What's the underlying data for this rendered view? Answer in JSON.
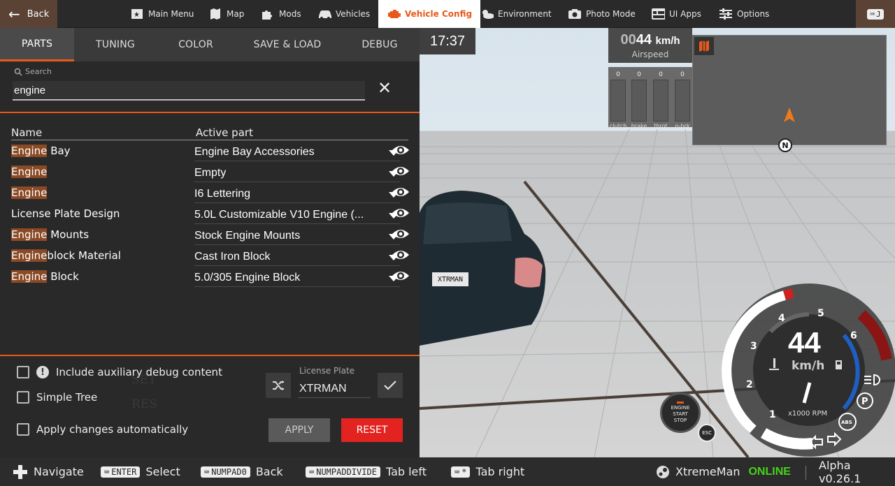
{
  "topbar": {
    "back_label": "Back",
    "nav": [
      {
        "label": "Main Menu",
        "icon": "main-menu-icon"
      },
      {
        "label": "Map",
        "icon": "map-icon"
      },
      {
        "label": "Mods",
        "icon": "puzzle-icon"
      },
      {
        "label": "Vehicles",
        "icon": "car-icon"
      },
      {
        "label": "Vehicle Config",
        "icon": "engine-icon",
        "active": true
      },
      {
        "label": "Environment",
        "icon": "weather-icon"
      },
      {
        "label": "Photo Mode",
        "icon": "camera-icon"
      },
      {
        "label": "UI Apps",
        "icon": "ui-apps-icon"
      },
      {
        "label": "Options",
        "icon": "sliders-icon"
      }
    ],
    "corner_key": "J"
  },
  "panel": {
    "tabs": [
      "PARTS",
      "TUNING",
      "COLOR",
      "SAVE & LOAD",
      "DEBUG"
    ],
    "active_tab": "PARTS",
    "search_label": "Search",
    "search_value": "engine",
    "col_name": "Name",
    "col_active": "Active part",
    "rows": [
      {
        "hl": "Engine",
        "rest": " Bay",
        "part": "Engine Bay Accessories"
      },
      {
        "hl": "Engine",
        "rest": "",
        "part": "Empty"
      },
      {
        "hl": "Engine",
        "rest": "",
        "part": "I6 Lettering"
      },
      {
        "hl": "",
        "rest": "License Plate Design",
        "part": "5.0L Customizable V10 Engine (..."
      },
      {
        "hl": "Engine",
        "rest": " Mounts",
        "part": "Stock Engine Mounts"
      },
      {
        "hl": "Engine",
        "rest": "block Material",
        "part": "Cast Iron Block"
      },
      {
        "hl": "Engine",
        "rest": " Block",
        "part": "5.0/305 Engine Block"
      }
    ],
    "options": {
      "aux_debug": "Include auxiliary debug content",
      "simple_tree": "Simple Tree",
      "apply_auto": "Apply changes automatically"
    },
    "license_plate_label": "License Plate",
    "license_plate_value": "XTRMAN",
    "apply_label": "APPLY",
    "reset_label": "RESET",
    "ghost": [
      "SET",
      "RES"
    ]
  },
  "hud": {
    "clock": "17:37",
    "airspeed_dim": "00",
    "airspeed_val": "44",
    "airspeed_unit": "km/h",
    "airspeed_label": "Airspeed",
    "pedals": [
      {
        "value": "0",
        "name": "clutch"
      },
      {
        "value": "0",
        "name": "brake"
      },
      {
        "value": "0",
        "name": "throt"
      },
      {
        "value": "0",
        "name": "p-brk"
      }
    ],
    "north": "N",
    "car_plate": "XTRMAN",
    "start_stop": [
      "ENGINE",
      "START",
      "STOP"
    ],
    "esc": "ESC",
    "gauge": {
      "speed": "44",
      "unit": "km/h",
      "rpm_label": "x1000 RPM",
      "ticks": [
        "1",
        "2",
        "3",
        "4",
        "5",
        "6"
      ],
      "park": "P",
      "abs": "ABS"
    }
  },
  "bottombar": {
    "navigate": "Navigate",
    "select_key": "ENTER",
    "select": "Select",
    "back_key": "NUMPAD0",
    "back": "Back",
    "tab_left_key": "NUMPADDIVIDE",
    "tab_left": "Tab left",
    "tab_right_key": "*",
    "tab_right": "Tab right",
    "user": "XtremeMan",
    "status": "ONLINE",
    "version": "Alpha v0.26.1"
  },
  "colors": {
    "accent": "#e85a1b",
    "reset": "#e2231f",
    "online": "#46d21c"
  }
}
